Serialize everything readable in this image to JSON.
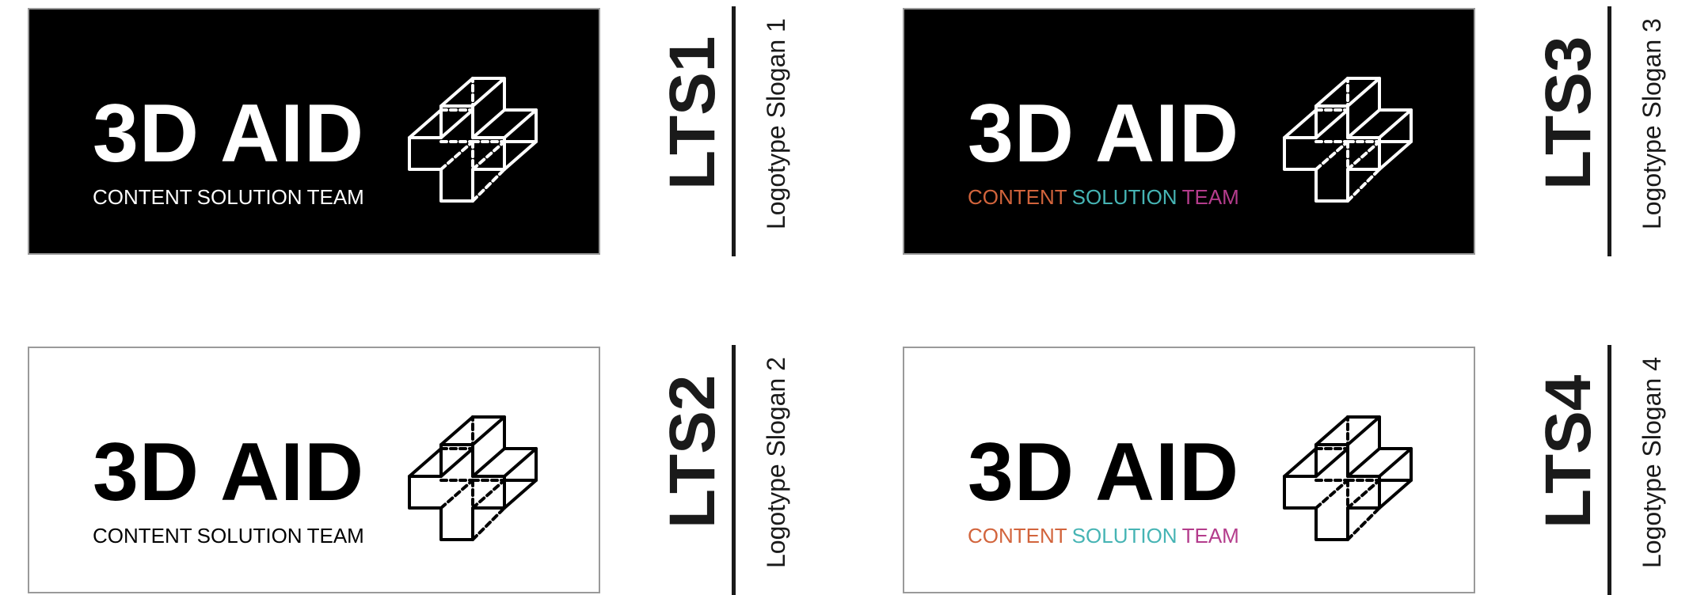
{
  "logos": [
    {
      "brand": "3D AID",
      "tagline": [
        "CONTENT",
        "SOLUTION",
        "TEAM"
      ],
      "code": "LTS1",
      "slogan": "Logotype Slogan 1",
      "theme": "dark",
      "colored": false
    },
    {
      "brand": "3D AID",
      "tagline": [
        "CONTENT",
        "SOLUTION",
        "TEAM"
      ],
      "code": "LTS2",
      "slogan": "Logotype Slogan 2",
      "theme": "light",
      "colored": false
    },
    {
      "brand": "3D AID",
      "tagline": [
        "CONTENT",
        "SOLUTION",
        "TEAM"
      ],
      "code": "LTS3",
      "slogan": "Logotype Slogan 3",
      "theme": "dark",
      "colored": true
    },
    {
      "brand": "3D AID",
      "tagline": [
        "CONTENT",
        "SOLUTION",
        "TEAM"
      ],
      "code": "LTS4",
      "slogan": "Logotype Slogan 4",
      "theme": "light",
      "colored": true
    }
  ],
  "tagline_colors": [
    "#d2643c",
    "#46b4b4",
    "#b43c8c"
  ],
  "icon": "medical-cross-3d-icon"
}
